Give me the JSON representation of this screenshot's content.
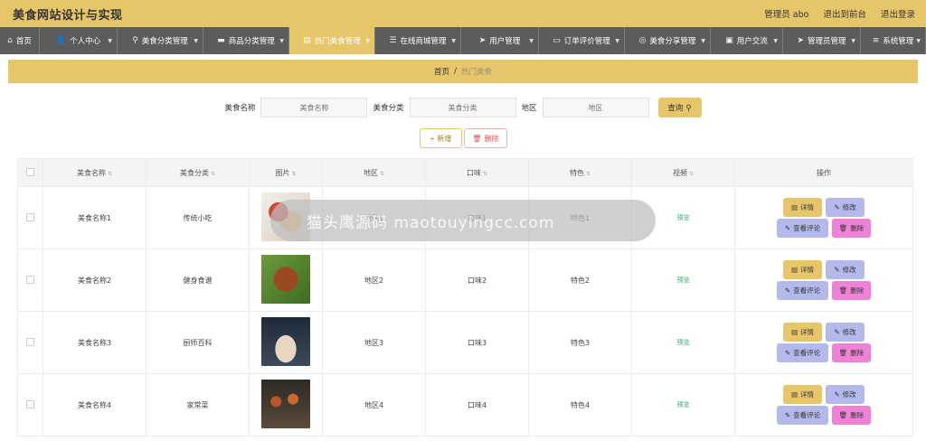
{
  "header": {
    "title": "美食网站设计与实现",
    "admin": "管理员 abo",
    "back_to_front": "退出到前台",
    "logout": "退出登录"
  },
  "nav": [
    {
      "label": "首页",
      "icon": "home-icon"
    },
    {
      "label": "个人中心",
      "icon": "user-icon"
    },
    {
      "label": "美食分类管理",
      "icon": "pin-icon"
    },
    {
      "label": "商品分类管理",
      "icon": "monitor-icon"
    },
    {
      "label": "热门美食管理",
      "icon": "doc-icon"
    },
    {
      "label": "在线商城管理",
      "icon": "list-icon"
    },
    {
      "label": "用户管理",
      "icon": "send-icon"
    },
    {
      "label": "订单评价管理",
      "icon": "card-icon"
    },
    {
      "label": "美食分享管理",
      "icon": "compass-icon"
    },
    {
      "label": "用户交流",
      "icon": "screen-icon"
    },
    {
      "label": "管理员管理",
      "icon": "send-icon"
    },
    {
      "label": "系统管理",
      "icon": "menu-icon"
    }
  ],
  "breadcrumb": {
    "home": "首页",
    "sep": "/",
    "current": "热门美食"
  },
  "search": {
    "name_label": "美食名称",
    "name_placeholder": "美食名称",
    "category_label": "美食分类",
    "category_placeholder": "美食分类",
    "region_label": "地区",
    "region_placeholder": "地区",
    "query_label": "查询"
  },
  "toolbar": {
    "add_label": "新增",
    "delete_label": "删除"
  },
  "table": {
    "headers": [
      "美食名称",
      "美食分类",
      "图片",
      "地区",
      "口味",
      "特色",
      "视频",
      "操作"
    ],
    "rows": [
      {
        "name": "美食名称1",
        "category": "传统小吃",
        "region": "地区1",
        "taste": "口味1",
        "feature": "特色1",
        "video": "预览"
      },
      {
        "name": "美食名称2",
        "category": "健身食谱",
        "region": "地区2",
        "taste": "口味2",
        "feature": "特色2",
        "video": "预览"
      },
      {
        "name": "美食名称3",
        "category": "厨师百科",
        "region": "地区3",
        "taste": "口味3",
        "feature": "特色3",
        "video": "预览"
      },
      {
        "name": "美食名称4",
        "category": "家常菜",
        "region": "地区4",
        "taste": "口味4",
        "feature": "特色4",
        "video": "预览"
      }
    ],
    "ops": {
      "detail": "详情",
      "edit": "修改",
      "comment": "查看评论",
      "delete": "删除"
    }
  },
  "watermark": {
    "band": "猫头鹰源码 maotouyingcc.com"
  },
  "colors": {
    "accent": "#e7c66a",
    "nav_bg": "#5c5c5c",
    "edit": "#b3b9ea",
    "delete": "#ee82d6",
    "preview": "#3ba46b"
  }
}
